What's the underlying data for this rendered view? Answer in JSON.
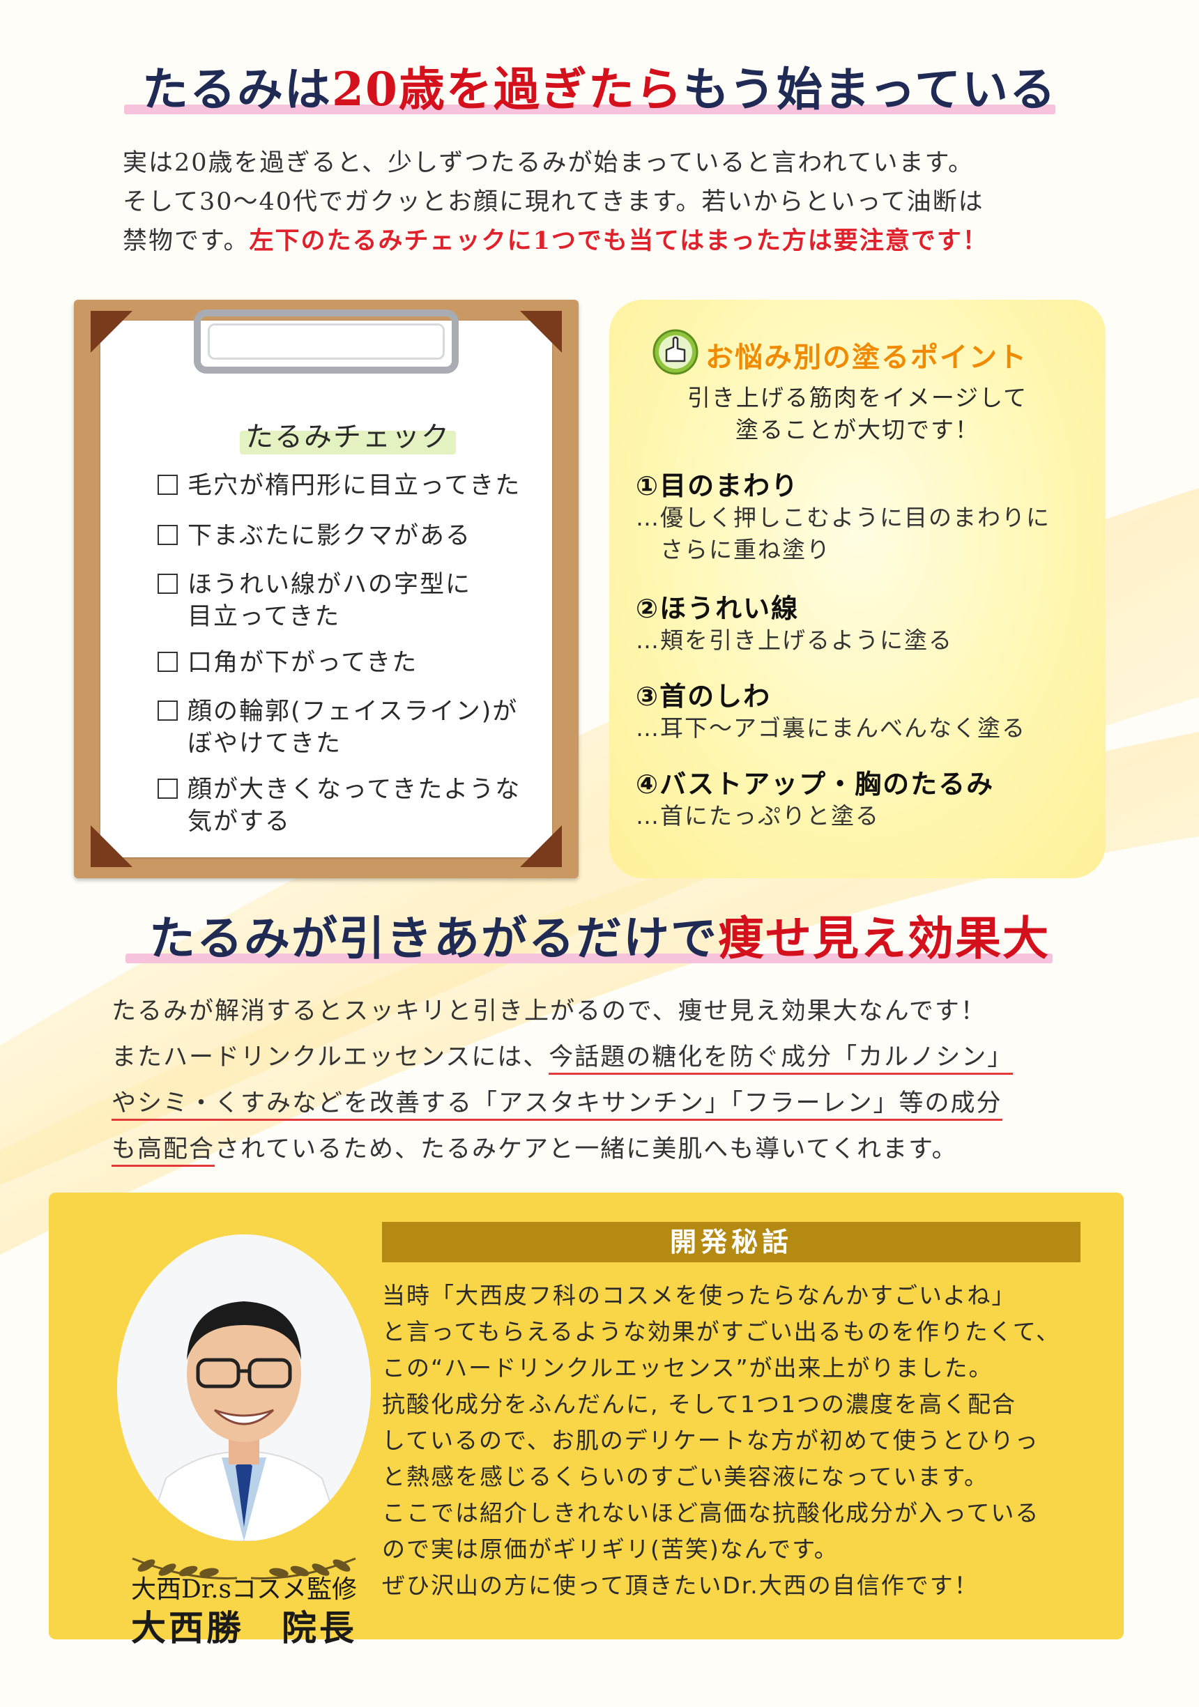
{
  "section1": {
    "headline_a": "たるみは",
    "headline_red": "20歳を過ぎたら",
    "headline_b": "もう始まっている",
    "lines": [
      "実は20歳を過ぎると、少しずつたるみが始まっていると言われています。",
      "そして30～40代でガクッとお顔に現れてきます。若いからといって油断は"
    ],
    "line3_a": "禁物です。",
    "line3_red": "左下のたるみチェックに1つでも当てはまった方は要注意です！"
  },
  "checklist": {
    "title": "たるみチェック",
    "items": [
      {
        "first": "毛穴が楕円形に目立ってきた",
        "cont": ""
      },
      {
        "first": "下まぶたに影クマがある",
        "cont": ""
      },
      {
        "first": "ほうれい線がハの字型に",
        "cont": "目立ってきた"
      },
      {
        "first": "口角が下がってきた",
        "cont": ""
      },
      {
        "first": "顔の輪郭(フェイスライン)が",
        "cont": "ぼやけてきた"
      },
      {
        "first": "顔が大きくなってきたような",
        "cont": "気がする"
      }
    ]
  },
  "points": {
    "title": "お悩み別の塗るポイント",
    "sub": [
      "引き上げる筋肉をイメージして",
      "塗ることが大切です！"
    ],
    "items": [
      {
        "head": "①目のまわり",
        "desc": [
          "…優しく押しこむように目のまわりに",
          "　さらに重ね塗り"
        ]
      },
      {
        "head": "②ほうれい線",
        "desc": [
          "…頬を引き上げるように塗る"
        ]
      },
      {
        "head": "③首のしわ",
        "desc": [
          "…耳下～アゴ裏にまんべんなく塗る"
        ]
      },
      {
        "head": "④バストアップ・胸のたるみ",
        "desc": [
          "…首にたっぷりと塗る"
        ]
      }
    ]
  },
  "section2": {
    "headline_a": "たるみが引きあがるだけで",
    "headline_red": "痩せ見え効果大",
    "line1": "たるみが解消するとスッキリと引き上がるので、痩せ見え効果大なんです！",
    "line2_a": "またハードリンクルエッセンスには、",
    "line2_u": "今話題の糖化を防ぐ成分「カルノシン」",
    "line3_u": "やシミ・くすみなどを改善する「アスタキサンチン」「フラーレン」等の成分",
    "line4_u": "も高配合",
    "line4_b": "されているため、たるみケアと一緒に美肌へも導いてくれます。"
  },
  "story": {
    "heading": "開発秘話",
    "supervisor_title": "大西Dr.sコスメ監修",
    "supervisor_name": "大西勝　院長",
    "lines": [
      "当時「大西皮フ科のコスメを使ったらなんかすごいよね」",
      "と言ってもらえるような効果がすごい出るものを作りたくて、",
      "この“ハードリンクルエッセンス”が出来上がりました。",
      "抗酸化成分をふんだんに, そして1つ1つの濃度を高く配合",
      "しているので、お肌のデリケートな方が初めて使うとひりっ",
      "と熱感を感じるくらいのすごい美容液になっています。",
      "ここでは紹介しきれないほど高価な抗酸化成分が入っている",
      "ので実は原価がギリギリ(苦笑)なんです。",
      "ぜひ沢山の方に使って頂きたいDr.大西の自信作です！"
    ]
  },
  "colors": {
    "navy": "#1f2a55",
    "red": "#d4101c",
    "yellow_box": "#f9d548",
    "story_heading": "#b58a12",
    "points_title": "#f08a00"
  }
}
